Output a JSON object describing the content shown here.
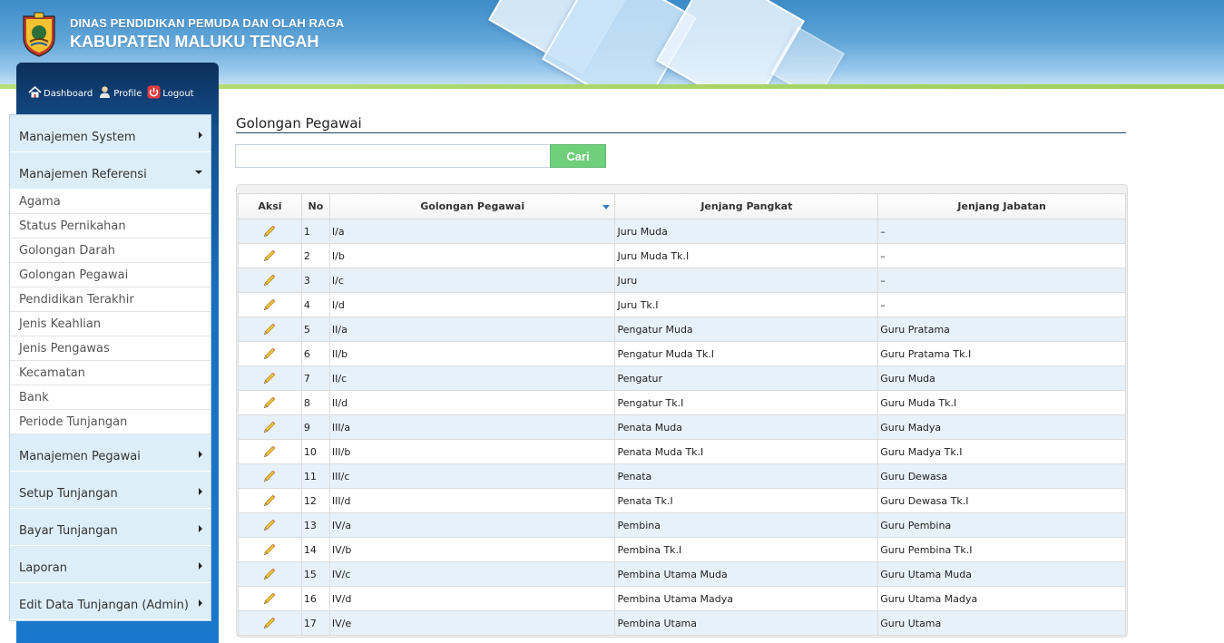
{
  "header": {
    "line1": "DINAS PENDIDIKAN PEMUDA DAN OLAH RAGA",
    "line2": "KABUPATEN MALUKU TENGAH"
  },
  "topnav": {
    "dashboard": "Dashboard",
    "profile": "Profile",
    "logout": "Logout"
  },
  "sidebar": {
    "manajemen_system": "Manajemen System",
    "manajemen_referensi": "Manajemen Referensi",
    "referensi_items": [
      "Agama",
      "Status Pernikahan",
      "Golongan Darah",
      "Golongan Pegawai",
      "Pendidikan Terakhir",
      "Jenis Keahlian",
      "Jenis Pengawas",
      "Kecamatan",
      "Bank",
      "Periode Tunjangan"
    ],
    "manajemen_pegawai": "Manajemen Pegawai",
    "setup_tunjangan": "Setup Tunjangan",
    "bayar_tunjangan": "Bayar Tunjangan",
    "laporan": "Laporan",
    "edit_data": "Edit Data Tunjangan (Admin)"
  },
  "main": {
    "title": "Golongan Pegawai",
    "search_value": "",
    "search_button": "Cari"
  },
  "table": {
    "headers": [
      "Aksi",
      "No",
      "Golongan Pegawai",
      "Jenjang Pangkat",
      "Jenjang Jabatan"
    ],
    "rows": [
      {
        "no": "1",
        "golongan": "I/a",
        "pangkat": "Juru Muda",
        "jabatan": "–"
      },
      {
        "no": "2",
        "golongan": "I/b",
        "pangkat": "Juru Muda Tk.I",
        "jabatan": "–"
      },
      {
        "no": "3",
        "golongan": "I/c",
        "pangkat": "Juru",
        "jabatan": "–"
      },
      {
        "no": "4",
        "golongan": "I/d",
        "pangkat": "Juru Tk.I",
        "jabatan": "–"
      },
      {
        "no": "5",
        "golongan": "II/a",
        "pangkat": "Pengatur Muda",
        "jabatan": "Guru Pratama"
      },
      {
        "no": "6",
        "golongan": "II/b",
        "pangkat": "Pengatur Muda Tk.I",
        "jabatan": "Guru Pratama Tk.I"
      },
      {
        "no": "7",
        "golongan": "II/c",
        "pangkat": "Pengatur",
        "jabatan": "Guru Muda"
      },
      {
        "no": "8",
        "golongan": "II/d",
        "pangkat": "Pengatur Tk.I",
        "jabatan": "Guru Muda Tk.I"
      },
      {
        "no": "9",
        "golongan": "III/a",
        "pangkat": "Penata Muda",
        "jabatan": "Guru Madya"
      },
      {
        "no": "10",
        "golongan": "III/b",
        "pangkat": "Penata Muda Tk.I",
        "jabatan": "Guru Madya Tk.I"
      },
      {
        "no": "11",
        "golongan": "III/c",
        "pangkat": "Penata",
        "jabatan": "Guru Dewasa"
      },
      {
        "no": "12",
        "golongan": "III/d",
        "pangkat": "Penata Tk.I",
        "jabatan": "Guru Dewasa Tk.I"
      },
      {
        "no": "13",
        "golongan": "IV/a",
        "pangkat": "Pembina",
        "jabatan": "Guru Pembina"
      },
      {
        "no": "14",
        "golongan": "IV/b",
        "pangkat": "Pembina Tk.I",
        "jabatan": "Guru Pembina Tk.I"
      },
      {
        "no": "15",
        "golongan": "IV/c",
        "pangkat": "Pembina Utama Muda",
        "jabatan": "Guru Utama Muda"
      },
      {
        "no": "16",
        "golongan": "IV/d",
        "pangkat": "Pembina Utama Madya",
        "jabatan": "Guru Utama Madya"
      },
      {
        "no": "17",
        "golongan": "IV/e",
        "pangkat": "Pembina Utama",
        "jabatan": "Guru Utama"
      }
    ]
  },
  "colors": {
    "accent_blue": "#1a6fbf",
    "button_green": "#6fcf7b",
    "row_alt": "#e7f1f9",
    "header_green_line": "#9fce5a"
  },
  "icons": [
    "home-icon",
    "user-icon",
    "power-icon",
    "pencil-icon",
    "chevron-right-icon",
    "chevron-down-icon",
    "sort-desc-icon"
  ]
}
